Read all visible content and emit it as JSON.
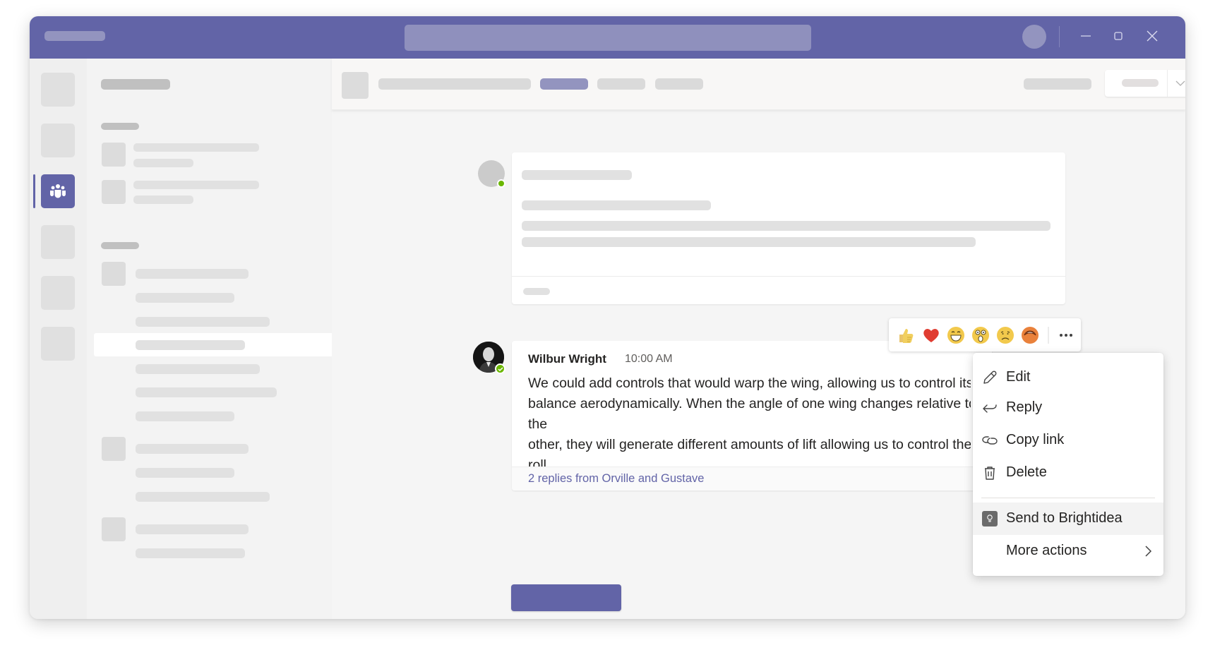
{
  "colors": {
    "brand": "#6264a7",
    "presence_available": "#6bb700",
    "link": "#6264a7",
    "text_primary": "#252423",
    "text_secondary": "#605e5c"
  },
  "titlebar": {
    "icons": {
      "minimize": "minimize-icon",
      "maximize": "maximize-icon",
      "close": "close-icon"
    }
  },
  "rail": {
    "active_icon": "teams-icon",
    "active_index": 2
  },
  "message": {
    "author": "Wilbur Wright",
    "time": "10:00 AM",
    "body": "We could add controls that would warp the wing, allowing us to control its\nbalance aerodynamically. When the angle of one wing changes relative to the\nother, they will generate different amounts of lift allowing us to control the roll\nand banking of the craft.",
    "replies": "2 replies from Orville and Gustave",
    "presence": "available"
  },
  "reactions": [
    {
      "name": "like",
      "icon": "thumbs-up-icon"
    },
    {
      "name": "heart",
      "icon": "heart-icon"
    },
    {
      "name": "laugh",
      "icon": "laugh-icon"
    },
    {
      "name": "surprised",
      "icon": "surprised-icon"
    },
    {
      "name": "sad",
      "icon": "sad-icon"
    },
    {
      "name": "angry",
      "icon": "angry-icon"
    }
  ],
  "context_menu": {
    "items": [
      {
        "label": "Edit",
        "icon": "pencil-icon"
      },
      {
        "label": "Reply",
        "icon": "reply-arrow-icon"
      },
      {
        "label": "Copy link",
        "icon": "link-icon"
      },
      {
        "label": "Delete",
        "icon": "trash-icon"
      },
      {
        "label": "Send to Brightidea",
        "icon": "brightidea-app-icon"
      },
      {
        "label": "More actions",
        "icon": "chevron-right-icon"
      }
    ]
  }
}
